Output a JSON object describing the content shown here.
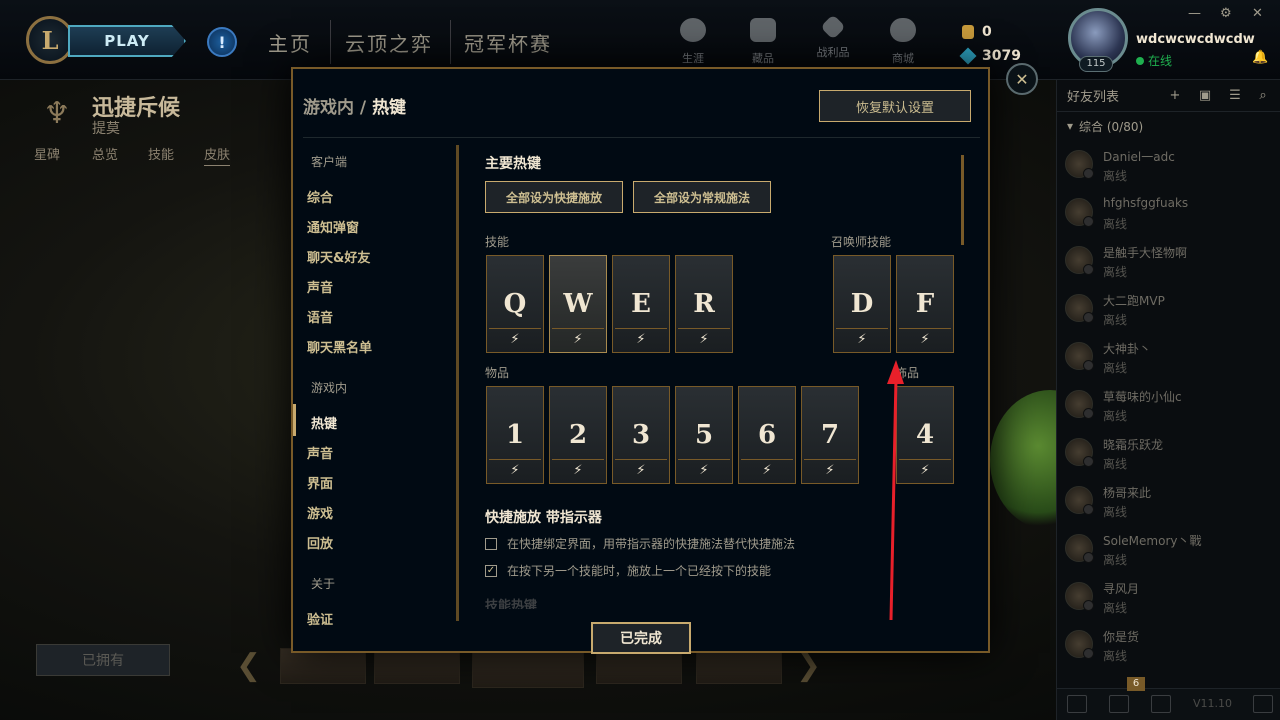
{
  "topbar": {
    "play_label": "PLAY",
    "alert_glyph": "!",
    "nav": [
      "主页",
      "云顶之弈",
      "冠军杯赛"
    ],
    "icons": [
      {
        "name": "career-icon",
        "label": "生涯"
      },
      {
        "name": "collection-icon",
        "label": "藏品"
      },
      {
        "name": "loot-icon",
        "label": "战利品"
      },
      {
        "name": "store-icon",
        "label": "商城"
      }
    ],
    "rp": "0",
    "be": "3079"
  },
  "profile": {
    "level": "115",
    "username": "wdcwcwcdwcdw",
    "status": "在线"
  },
  "friends": {
    "title": "好友列表",
    "group": "综合 (0/80)",
    "list": [
      {
        "name": "Daniel一adc",
        "status": "离线"
      },
      {
        "name": "hfghsfggfuaks",
        "status": "离线"
      },
      {
        "name": "是触手大怪物啊",
        "status": "离线"
      },
      {
        "name": "大二跑MVP",
        "status": "离线"
      },
      {
        "name": "大神卦丶",
        "status": "离线"
      },
      {
        "name": "草莓味的小仙c",
        "status": "离线"
      },
      {
        "name": "晓霜乐跃龙",
        "status": "离线"
      },
      {
        "name": "杨哥来此",
        "status": "离线"
      },
      {
        "name": "SoleMemory丶戰",
        "status": "离线"
      },
      {
        "name": "寻风月",
        "status": "离线"
      },
      {
        "name": "你是货",
        "status": "离线"
      }
    ],
    "badge": "6",
    "version": "V11.10"
  },
  "background_page": {
    "champion_name": "迅捷斥候",
    "champion_title": "提莫",
    "tabs": [
      "星碑",
      "总览",
      "技能",
      "皮肤"
    ],
    "owned_label": "已拥有"
  },
  "modal": {
    "breadcrumb_parent": "游戏内",
    "breadcrumb_sep": "/",
    "breadcrumb_current": "热键",
    "restore_label": "恢复默认设置",
    "close_glyph": "✕",
    "done_label": "已完成",
    "nav": {
      "client_header": "客户端",
      "client_items": [
        "综合",
        "通知弹窗",
        "聊天&好友",
        "声音",
        "语音",
        "聊天黑名单"
      ],
      "ingame_header": "游戏内",
      "ingame_items": [
        "热键",
        "声音",
        "界面",
        "游戏",
        "回放"
      ],
      "about_header": "关于",
      "about_items": [
        "验证"
      ]
    },
    "content": {
      "main_title": "主要热键",
      "quick_all_label": "全部设为快捷施放",
      "normal_all_label": "全部设为常规施法",
      "abilities_label": "技能",
      "summoner_label": "召唤师技能",
      "ability_keys": [
        "Q",
        "W",
        "E",
        "R"
      ],
      "summoner_keys": [
        "D",
        "F"
      ],
      "items_label": "物品",
      "item_keys": [
        "1",
        "2",
        "3",
        "5",
        "6",
        "7"
      ],
      "trinket_label": "饰品",
      "trinket_key": "4",
      "cast_glyph": "⚡",
      "indicator_title": "快捷施放 带指示器",
      "option1": "在快捷绑定界面，用带指示器的快捷施法替代快捷施法",
      "option1_checked": false,
      "option2": "在按下另一个技能时，施放上一个已经按下的技能",
      "option2_checked": true,
      "faded_heading": "技能热键"
    }
  },
  "colors": {
    "gold": "#c8aa6e",
    "gold_dark": "#785a28",
    "annotation_red": "#e8202a",
    "online_green": "#1fb04f"
  }
}
